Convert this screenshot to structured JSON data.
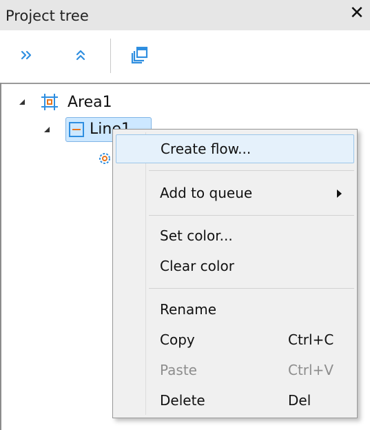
{
  "panel": {
    "title": "Project tree",
    "close_icon": "close-icon",
    "toolbar": {
      "buttons": [
        {
          "icon": "double-chevron-right-icon",
          "name": "expand-all"
        },
        {
          "icon": "double-chevron-up-icon",
          "name": "collapse-all"
        },
        {
          "icon": "copy-windows-icon",
          "name": "duplicate-view"
        }
      ]
    }
  },
  "tree": {
    "nodes": [
      {
        "label": "Area1",
        "icon": "area-icon",
        "expanded": true,
        "level": 0
      },
      {
        "label": "Line1",
        "icon": "line-icon",
        "expanded": true,
        "level": 1,
        "selected": true
      },
      {
        "label": "",
        "icon": "gear-icon",
        "level": 2
      }
    ]
  },
  "context_menu": {
    "items": [
      {
        "label": "Create flow...",
        "shortcut": "",
        "hover": true,
        "enabled": true
      },
      {
        "label": "Add to queue",
        "shortcut": "",
        "submenu": true,
        "enabled": true
      },
      {
        "label": "Set color...",
        "shortcut": "",
        "enabled": true
      },
      {
        "label": "Clear color",
        "shortcut": "",
        "enabled": true
      },
      {
        "label": "Rename",
        "shortcut": "",
        "enabled": true
      },
      {
        "label": "Copy",
        "shortcut": "Ctrl+C",
        "enabled": true
      },
      {
        "label": "Paste",
        "shortcut": "Ctrl+V",
        "enabled": false
      },
      {
        "label": "Delete",
        "shortcut": "Del",
        "enabled": true
      }
    ]
  },
  "colors": {
    "accent": "#2e8ee0",
    "node_icon_orange": "#e8741c",
    "selection_fill": "#cde8ff",
    "selection_border": "#7fb4e6",
    "menu_bg": "#f0f0f0",
    "menu_hover": "#e5f1fb",
    "disabled_text": "#8d8d8d"
  }
}
